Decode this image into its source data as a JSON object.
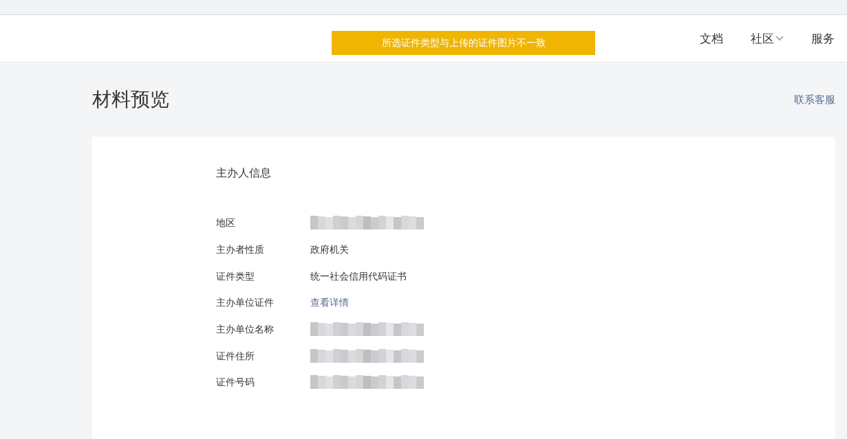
{
  "banner": {
    "message": "所选证件类型与上传的证件图片不一致"
  },
  "nav": [
    {
      "label": "文档",
      "dropdown": false
    },
    {
      "label": "社区",
      "dropdown": true
    },
    {
      "label": "服务",
      "dropdown": false
    }
  ],
  "page": {
    "title": "材料预览",
    "help_link": "联系客服"
  },
  "sections": [
    {
      "title": "主办人信息",
      "rows": [
        {
          "label": "地区",
          "kind": "redacted"
        },
        {
          "label": "主办者性质",
          "kind": "text",
          "value": "政府机关"
        },
        {
          "label": "证件类型",
          "kind": "text",
          "value": "统一社会信用代码证书"
        },
        {
          "label": "主办单位证件",
          "kind": "link",
          "value": "查看详情"
        },
        {
          "label": "主办单位名称",
          "kind": "redacted"
        },
        {
          "label": "证件住所",
          "kind": "redacted"
        },
        {
          "label": "证件号码",
          "kind": "redacted"
        }
      ]
    }
  ]
}
